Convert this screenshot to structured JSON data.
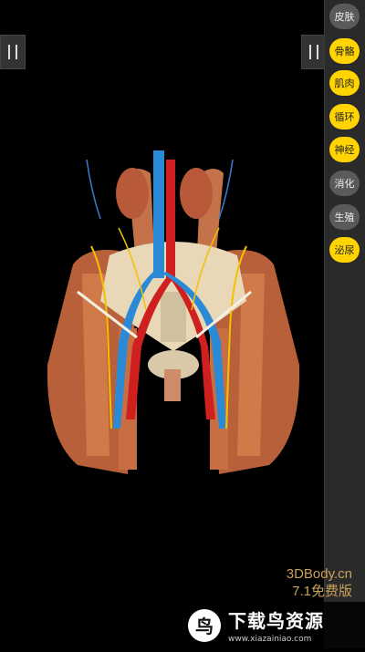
{
  "viewer": {
    "model_description_icon": "pelvis-anatomy-model"
  },
  "controls": {
    "left_pause_icon": "pause-icon",
    "right_pause_icon": "pause-icon"
  },
  "layers": [
    {
      "label": "皮肤",
      "active": false
    },
    {
      "label": "骨骼",
      "active": true
    },
    {
      "label": "肌肉",
      "active": true
    },
    {
      "label": "循环",
      "active": true
    },
    {
      "label": "神经",
      "active": true
    },
    {
      "label": "消化",
      "active": false
    },
    {
      "label": "生殖",
      "active": false
    },
    {
      "label": "泌尿",
      "active": true
    }
  ],
  "brand": {
    "site": "3DBody.cn",
    "version": "7.1免费版"
  },
  "watermark": {
    "title": "下载鸟资源",
    "url": "www.xiazainiao.com",
    "logo_char": "鸟"
  },
  "colors": {
    "active_layer": "#ffd400",
    "inactive_layer": "#5a5a5a",
    "brand_text": "#c9a15a"
  }
}
